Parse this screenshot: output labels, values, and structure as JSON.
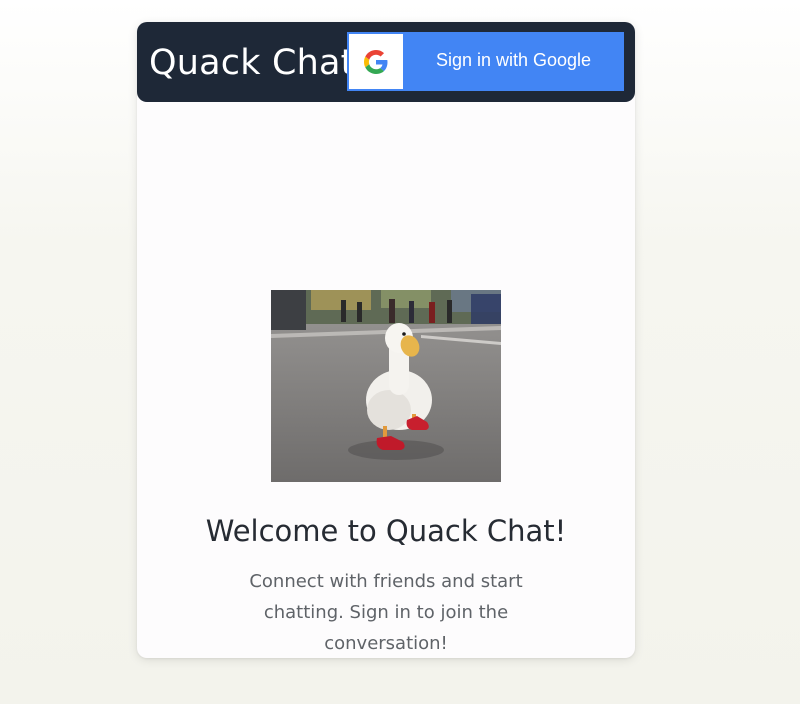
{
  "header": {
    "title": "Quack Chat",
    "sign_in_label": "Sign in with Google",
    "sign_in_icon": "google-g-icon",
    "colors": {
      "header_bg": "#1e2837",
      "button_bg": "#4285f4"
    }
  },
  "main": {
    "image": "duck-walking-in-red-shoes",
    "heading": "Welcome to Quack Chat!",
    "description": "Connect with friends and start chatting. Sign in to join the conversation!"
  }
}
